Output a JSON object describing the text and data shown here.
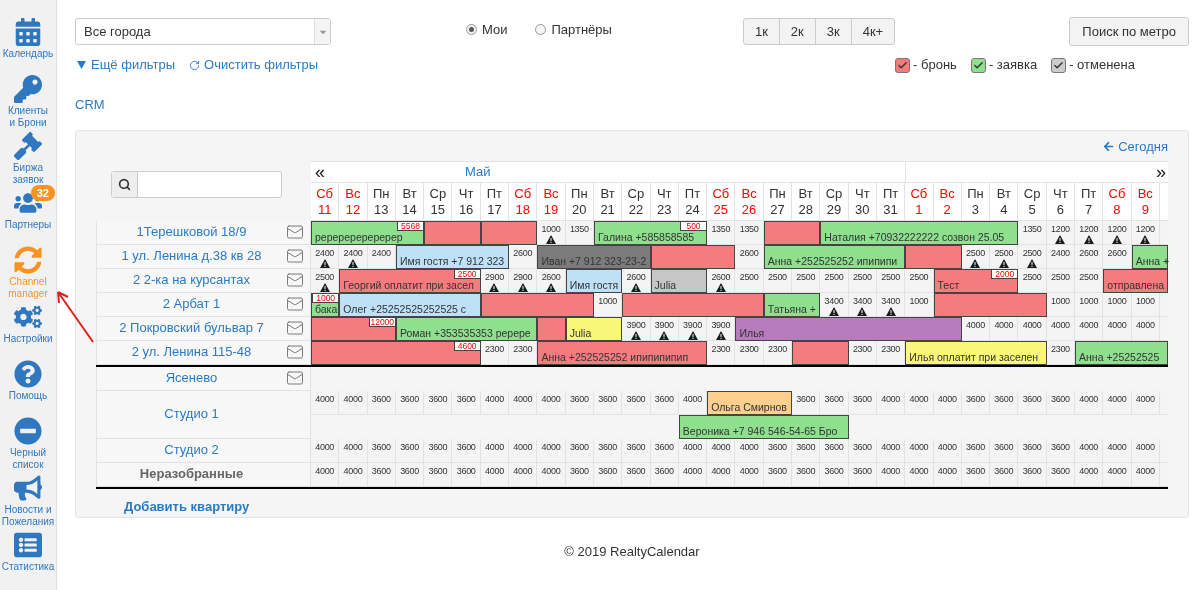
{
  "sidebar": {
    "items": [
      {
        "label": "Календарь",
        "selected": false
      },
      {
        "label": "Клиенты\nи Брони",
        "selected": false
      },
      {
        "label": "Биржа\nзаявок",
        "selected": false
      },
      {
        "label": "Партнеры",
        "selected": false,
        "badge": "32"
      },
      {
        "label": "Channel\nmanager",
        "selected": true
      },
      {
        "label": "Настройки",
        "selected": false
      },
      {
        "label": "Помощь",
        "selected": false
      },
      {
        "label": "Черный\nсписок",
        "selected": false
      },
      {
        "label": "Новости и\nПожелания",
        "selected": false
      },
      {
        "label": "Статистика",
        "selected": false
      }
    ]
  },
  "filters": {
    "city_select": "Все города",
    "scope": [
      {
        "label": "Мои",
        "selected": true
      },
      {
        "label": "Партнёры",
        "selected": false
      }
    ],
    "rooms": [
      "1к",
      "2к",
      "3к",
      "4к+"
    ],
    "metro_button": "Поиск по метро",
    "more_filters": "Ещё фильтры",
    "clear_filters": "Очистить фильтры",
    "legend": [
      {
        "label": "- бронь",
        "color": "#f47c7c"
      },
      {
        "label": "- заявка",
        "color": "#8ee08e"
      },
      {
        "label": "- отменена",
        "color": "#cccccc"
      }
    ],
    "crm_link": "CRM"
  },
  "calendar": {
    "today_link": "Сегодня",
    "prev": "«",
    "next": "»",
    "months": [
      {
        "label": "Май",
        "days": [
          {
            "weekday": "Сб",
            "date": "11",
            "weekend": true
          },
          {
            "weekday": "Вс",
            "date": "12",
            "weekend": true
          },
          {
            "weekday": "Пн",
            "date": "13",
            "weekend": false
          },
          {
            "weekday": "Вт",
            "date": "14",
            "weekend": false
          },
          {
            "weekday": "Ср",
            "date": "15",
            "weekend": false
          },
          {
            "weekday": "Чт",
            "date": "16",
            "weekend": false
          },
          {
            "weekday": "Пт",
            "date": "17",
            "weekend": false
          },
          {
            "weekday": "Сб",
            "date": "18",
            "weekend": true
          },
          {
            "weekday": "Вс",
            "date": "19",
            "weekend": true
          },
          {
            "weekday": "Пн",
            "date": "20",
            "weekend": false
          },
          {
            "weekday": "Вт",
            "date": "21",
            "weekend": false
          },
          {
            "weekday": "Ср",
            "date": "22",
            "weekend": false
          },
          {
            "weekday": "Чт",
            "date": "23",
            "weekend": false
          },
          {
            "weekday": "Пт",
            "date": "24",
            "weekend": false
          },
          {
            "weekday": "Сб",
            "date": "25",
            "weekend": true
          },
          {
            "weekday": "Вс",
            "date": "26",
            "weekend": true
          },
          {
            "weekday": "Пн",
            "date": "27",
            "weekend": false
          },
          {
            "weekday": "Вт",
            "date": "28",
            "weekend": false
          },
          {
            "weekday": "Ср",
            "date": "29",
            "weekend": false
          },
          {
            "weekday": "Чт",
            "date": "30",
            "weekend": false
          },
          {
            "weekday": "Пт",
            "date": "31",
            "weekend": false
          }
        ]
      },
      {
        "days": [
          {
            "weekday": "Сб",
            "date": "1",
            "weekend": true
          },
          {
            "weekday": "Вс",
            "date": "2",
            "weekend": true
          },
          {
            "weekday": "Пн",
            "date": "3",
            "weekend": false
          },
          {
            "weekday": "Вт",
            "date": "4",
            "weekend": false
          },
          {
            "weekday": "Ср",
            "date": "5",
            "weekend": false
          },
          {
            "weekday": "Чт",
            "date": "6",
            "weekend": false
          },
          {
            "weekday": "Пт",
            "date": "7",
            "weekend": false
          },
          {
            "weekday": "Сб",
            "date": "8",
            "weekend": true
          },
          {
            "weekday": "Вс",
            "date": "9",
            "weekend": true
          }
        ]
      }
    ],
    "rows": [
      {
        "kind": "apartment",
        "name": "1Терешковой 18/9",
        "mail": true,
        "lanes": [
          [
            {
              "kind": "booking",
              "text": "реререререререр",
              "color": "#8ee08e",
              "tag": "5568"
            },
            {
              "kind": "continued"
            },
            {
              "kind": "continued"
            },
            {
              "kind": "continued"
            },
            {
              "kind": "booking",
              "color": "#f47c7c"
            },
            {
              "kind": "continued"
            },
            {
              "kind": "booking",
              "color": "#f47c7c"
            },
            {
              "kind": "continued"
            },
            {
              "kind": "price",
              "price": "1000",
              "warning": true
            },
            {
              "kind": "price",
              "price": "1350",
              "warning": false
            },
            {
              "kind": "booking",
              "text": "Галина +585858585",
              "color": "#8ee08e",
              "tag": "500"
            },
            {
              "kind": "continued"
            },
            {
              "kind": "continued"
            },
            {
              "kind": "continued"
            },
            {
              "kind": "price",
              "price": "1350",
              "warning": false
            },
            {
              "kind": "price",
              "price": "1350",
              "warning": false
            },
            {
              "kind": "booking",
              "color": "#f47c7c"
            },
            {
              "kind": "continued"
            },
            {
              "kind": "booking",
              "text": "Наталия +70932222222 созвон 25.05",
              "color": "#8ee08e"
            },
            {
              "kind": "continued"
            },
            {
              "kind": "continued"
            },
            {
              "kind": "continued"
            },
            {
              "kind": "continued"
            },
            {
              "kind": "continued"
            },
            {
              "kind": "continued"
            },
            {
              "kind": "price",
              "price": "1350",
              "warning": false
            },
            {
              "kind": "price",
              "price": "1200",
              "warning": true
            },
            {
              "kind": "price",
              "price": "1200",
              "warning": true
            },
            {
              "kind": "price",
              "price": "1200",
              "warning": true
            },
            {
              "kind": "price",
              "price": "1200",
              "warning": true
            }
          ]
        ]
      },
      {
        "kind": "apartment",
        "name": "1 ул. Ленина д.38 кв 28",
        "mail": true,
        "lanes": [
          [
            {
              "kind": "price",
              "price": "2400",
              "warning": true
            },
            {
              "kind": "price",
              "price": "2400",
              "warning": true
            },
            {
              "kind": "price",
              "price": "2400",
              "warning": false
            },
            {
              "kind": "booking",
              "text": "Имя гостя +7 912 323",
              "color": "#bfe1f7"
            },
            {
              "kind": "continued"
            },
            {
              "kind": "continued"
            },
            {
              "kind": "continued"
            },
            {
              "kind": "price",
              "price": "2600",
              "warning": false
            },
            {
              "kind": "booking",
              "text": "Иван +7 912 323-23-2",
              "color": "#7b7b7b"
            },
            {
              "kind": "continued"
            },
            {
              "kind": "continued"
            },
            {
              "kind": "continued"
            },
            {
              "kind": "booking",
              "color": "#f47c7c"
            },
            {
              "kind": "continued"
            },
            {
              "kind": "continued"
            },
            {
              "kind": "price",
              "price": "2600",
              "warning": false
            },
            {
              "kind": "booking",
              "text": "Анна +252525252 ипипипи",
              "color": "#8ee08e"
            },
            {
              "kind": "continued"
            },
            {
              "kind": "continued"
            },
            {
              "kind": "continued"
            },
            {
              "kind": "continued"
            },
            {
              "kind": "booking",
              "color": "#f47c7c"
            },
            {
              "kind": "continued"
            },
            {
              "kind": "price",
              "price": "2500",
              "warning": true
            },
            {
              "kind": "price",
              "price": "2500",
              "warning": true
            },
            {
              "kind": "price",
              "price": "2500",
              "warning": true
            },
            {
              "kind": "price",
              "price": "2400",
              "warning": false
            },
            {
              "kind": "price",
              "price": "2600",
              "warning": false
            },
            {
              "kind": "price",
              "price": "2600",
              "warning": false
            },
            {
              "kind": "booking",
              "text": "Анна +",
              "color": "#8ee08e"
            }
          ]
        ]
      },
      {
        "kind": "apartment",
        "name": "2 2-ка на курсантах",
        "mail": true,
        "lanes": [
          [
            {
              "kind": "price",
              "price": "2500",
              "warning": true
            },
            {
              "kind": "booking",
              "text": "Георгий оплатит при засел",
              "color": "#f47c7c",
              "tag": "2500"
            },
            {
              "kind": "continued"
            },
            {
              "kind": "continued"
            },
            {
              "kind": "continued"
            },
            {
              "kind": "continued"
            },
            {
              "kind": "price",
              "price": "2900",
              "warning": true
            },
            {
              "kind": "price",
              "price": "2900",
              "warning": true
            },
            {
              "kind": "price",
              "price": "2600",
              "warning": true
            },
            {
              "kind": "booking",
              "text": "Имя гостя",
              "color": "#bfe1f7"
            },
            {
              "kind": "continued"
            },
            {
              "kind": "price",
              "price": "2600",
              "warning": true
            },
            {
              "kind": "booking",
              "text": "Julia",
              "color": "#c6c6c6"
            },
            {
              "kind": "continued"
            },
            {
              "kind": "price",
              "price": "2600",
              "warning": true
            },
            {
              "kind": "price",
              "price": "2500",
              "warning": false
            },
            {
              "kind": "price",
              "price": "2500",
              "warning": false
            },
            {
              "kind": "price",
              "price": "2500",
              "warning": false
            },
            {
              "kind": "price",
              "price": "2500",
              "warning": false
            },
            {
              "kind": "price",
              "price": "2500",
              "warning": false
            },
            {
              "kind": "price",
              "price": "2500",
              "warning": false
            },
            {
              "kind": "price",
              "price": "2500",
              "warning": false
            },
            {
              "kind": "booking",
              "text": "Тест",
              "color": "#f47c7c",
              "tag": "2000"
            },
            {
              "kind": "continued"
            },
            {
              "kind": "continued"
            },
            {
              "kind": "price",
              "price": "2500",
              "warning": false
            },
            {
              "kind": "price",
              "price": "2500",
              "warning": false
            },
            {
              "kind": "price",
              "price": "2500",
              "warning": false
            },
            {
              "kind": "booking",
              "text": "отправлена",
              "color": "#f47c7c"
            },
            {
              "kind": "continued"
            }
          ]
        ]
      },
      {
        "kind": "apartment",
        "name": "2 Арбат 1",
        "mail": true,
        "lanes": [
          [
            {
              "kind": "booking",
              "text": "бака",
              "color": "#8ee08e",
              "tag": "1000"
            },
            {
              "kind": "booking",
              "text": "Олег +25252525252525 с",
              "color": "#bfe1f7"
            },
            {
              "kind": "continued"
            },
            {
              "kind": "continued"
            },
            {
              "kind": "continued"
            },
            {
              "kind": "continued"
            },
            {
              "kind": "booking",
              "color": "#f47c7c"
            },
            {
              "kind": "continued"
            },
            {
              "kind": "continued"
            },
            {
              "kind": "continued"
            },
            {
              "kind": "price",
              "price": "1000",
              "warning": false
            },
            {
              "kind": "booking",
              "color": "#f47c7c"
            },
            {
              "kind": "continued"
            },
            {
              "kind": "continued"
            },
            {
              "kind": "continued"
            },
            {
              "kind": "continued"
            },
            {
              "kind": "booking",
              "text": "Татьяна +",
              "color": "#8ee08e"
            },
            {
              "kind": "continued"
            },
            {
              "kind": "price",
              "price": "3400",
              "warning": true
            },
            {
              "kind": "price",
              "price": "3400",
              "warning": true
            },
            {
              "kind": "price",
              "price": "3400",
              "warning": true
            },
            {
              "kind": "price",
              "price": "1000",
              "warning": false
            },
            {
              "kind": "booking",
              "color": "#f47c7c"
            },
            {
              "kind": "continued"
            },
            {
              "kind": "continued"
            },
            {
              "kind": "continued"
            },
            {
              "kind": "price",
              "price": "1000",
              "warning": false
            },
            {
              "kind": "price",
              "price": "1000",
              "warning": false
            },
            {
              "kind": "price",
              "price": "1000",
              "warning": false
            },
            {
              "kind": "price",
              "price": "1000",
              "warning": false
            }
          ]
        ]
      },
      {
        "kind": "apartment",
        "name": "2 Покровский бульвар 7",
        "mail": true,
        "lanes": [
          [
            {
              "kind": "booking",
              "color": "#f47c7c",
              "tag": "12000"
            },
            {
              "kind": "continued"
            },
            {
              "kind": "continued"
            },
            {
              "kind": "booking",
              "text": "Роман +353535353 ререре",
              "color": "#8ee08e"
            },
            {
              "kind": "continued"
            },
            {
              "kind": "continued"
            },
            {
              "kind": "continued"
            },
            {
              "kind": "continued"
            },
            {
              "kind": "booking",
              "color": "#f47c7c"
            },
            {
              "kind": "booking",
              "text": "Julia",
              "color": "#faf67a"
            },
            {
              "kind": "continued"
            },
            {
              "kind": "price",
              "price": "3900",
              "warning": true
            },
            {
              "kind": "price",
              "price": "3900",
              "warning": true
            },
            {
              "kind": "price",
              "price": "3900",
              "warning": true
            },
            {
              "kind": "price",
              "price": "3900",
              "warning": true
            },
            {
              "kind": "booking",
              "text": "Илья",
              "color": "#b87bbd"
            },
            {
              "kind": "continued"
            },
            {
              "kind": "continued"
            },
            {
              "kind": "continued"
            },
            {
              "kind": "continued"
            },
            {
              "kind": "continued"
            },
            {
              "kind": "continued"
            },
            {
              "kind": "continued"
            },
            {
              "kind": "price",
              "price": "4000",
              "warning": false
            },
            {
              "kind": "price",
              "price": "4000",
              "warning": false
            },
            {
              "kind": "price",
              "price": "4000",
              "warning": false
            },
            {
              "kind": "price",
              "price": "4000",
              "warning": false
            },
            {
              "kind": "price",
              "price": "4000",
              "warning": false
            },
            {
              "kind": "price",
              "price": "4000",
              "warning": false
            },
            {
              "kind": "price",
              "price": "4000",
              "warning": false
            }
          ]
        ]
      },
      {
        "kind": "apartment",
        "name": "2 ул. Ленина 115-48",
        "mail": true,
        "lanes": [
          [
            {
              "kind": "booking",
              "color": "#f47c7c",
              "tag": "4600"
            },
            {
              "kind": "continued"
            },
            {
              "kind": "continued"
            },
            {
              "kind": "continued"
            },
            {
              "kind": "continued"
            },
            {
              "kind": "continued"
            },
            {
              "kind": "price",
              "price": "2300",
              "warning": false
            },
            {
              "kind": "price",
              "price": "2300",
              "warning": false
            },
            {
              "kind": "booking",
              "text": "Анна +252525252 ипипипипип",
              "color": "#f47c7c"
            },
            {
              "kind": "continued"
            },
            {
              "kind": "continued"
            },
            {
              "kind": "continued"
            },
            {
              "kind": "continued"
            },
            {
              "kind": "continued"
            },
            {
              "kind": "price",
              "price": "2300",
              "warning": false
            },
            {
              "kind": "price",
              "price": "2300",
              "warning": false
            },
            {
              "kind": "price",
              "price": "2300",
              "warning": false
            },
            {
              "kind": "booking",
              "color": "#f47c7c"
            },
            {
              "kind": "continued"
            },
            {
              "kind": "price",
              "price": "2300",
              "warning": false
            },
            {
              "kind": "price",
              "price": "2300",
              "warning": false
            },
            {
              "kind": "booking",
              "text": "Илья оплатит при заселен",
              "color": "#faf67a"
            },
            {
              "kind": "continued"
            },
            {
              "kind": "continued"
            },
            {
              "kind": "continued"
            },
            {
              "kind": "continued"
            },
            {
              "kind": "price",
              "price": "2300",
              "warning": false
            },
            {
              "kind": "booking",
              "text": "Анна +25252525",
              "color": "#8ee08e"
            },
            {
              "kind": "continued"
            },
            {
              "kind": "continued"
            }
          ]
        ]
      },
      {
        "kind": "group",
        "name": "Ясенево",
        "mail": true,
        "lanes": [
          [
            {
              "kind": "blank"
            },
            {
              "kind": "blank"
            },
            {
              "kind": "blank"
            },
            {
              "kind": "blank"
            },
            {
              "kind": "blank"
            },
            {
              "kind": "blank"
            },
            {
              "kind": "blank"
            },
            {
              "kind": "blank"
            },
            {
              "kind": "blank"
            },
            {
              "kind": "blank"
            },
            {
              "kind": "blank"
            },
            {
              "kind": "blank"
            },
            {
              "kind": "blank"
            },
            {
              "kind": "blank"
            },
            {
              "kind": "blank"
            },
            {
              "kind": "blank"
            },
            {
              "kind": "blank"
            },
            {
              "kind": "blank"
            },
            {
              "kind": "blank"
            },
            {
              "kind": "blank"
            },
            {
              "kind": "blank"
            },
            {
              "kind": "blank"
            },
            {
              "kind": "blank"
            },
            {
              "kind": "blank"
            },
            {
              "kind": "blank"
            },
            {
              "kind": "blank"
            },
            {
              "kind": "blank"
            },
            {
              "kind": "blank"
            },
            {
              "kind": "blank"
            },
            {
              "kind": "blank"
            }
          ]
        ]
      },
      {
        "kind": "apartment",
        "name": "Студио 1",
        "mail": false,
        "lanes": [
          [
            {
              "kind": "price",
              "price": "4000",
              "warning": false
            },
            {
              "kind": "price",
              "price": "4000",
              "warning": false
            },
            {
              "kind": "price",
              "price": "3600",
              "warning": false
            },
            {
              "kind": "price",
              "price": "3600",
              "warning": false
            },
            {
              "kind": "price",
              "price": "3600",
              "warning": false
            },
            {
              "kind": "price",
              "price": "3600",
              "warning": false
            },
            {
              "kind": "price",
              "price": "4000",
              "warning": false
            },
            {
              "kind": "price",
              "price": "4000",
              "warning": false
            },
            {
              "kind": "price",
              "price": "4000",
              "warning": false
            },
            {
              "kind": "price",
              "price": "3600",
              "warning": false
            },
            {
              "kind": "price",
              "price": "3600",
              "warning": false
            },
            {
              "kind": "price",
              "price": "3600",
              "warning": false
            },
            {
              "kind": "price",
              "price": "3600",
              "warning": false
            },
            {
              "kind": "price",
              "price": "4000",
              "warning": false
            },
            {
              "kind": "booking",
              "text": "Ольга Смирнов",
              "color": "#fbd08e"
            },
            {
              "kind": "continued"
            },
            {
              "kind": "continued"
            },
            {
              "kind": "price",
              "price": "3600",
              "warning": false
            },
            {
              "kind": "price",
              "price": "3600",
              "warning": false
            },
            {
              "kind": "price",
              "price": "3600",
              "warning": false
            },
            {
              "kind": "price",
              "price": "4000",
              "warning": false
            },
            {
              "kind": "price",
              "price": "4000",
              "warning": false
            },
            {
              "kind": "price",
              "price": "4000",
              "warning": false
            },
            {
              "kind": "price",
              "price": "3600",
              "warning": false
            },
            {
              "kind": "price",
              "price": "3600",
              "warning": false
            },
            {
              "kind": "price",
              "price": "3600",
              "warning": false
            },
            {
              "kind": "price",
              "price": "3600",
              "warning": false
            },
            {
              "kind": "price",
              "price": "4000",
              "warning": false
            },
            {
              "kind": "price",
              "price": "4000",
              "warning": false
            },
            {
              "kind": "price",
              "price": "4000",
              "warning": false
            }
          ],
          [
            {
              "kind": "blank"
            },
            {
              "kind": "blank"
            },
            {
              "kind": "blank"
            },
            {
              "kind": "blank"
            },
            {
              "kind": "blank"
            },
            {
              "kind": "blank"
            },
            {
              "kind": "blank"
            },
            {
              "kind": "blank"
            },
            {
              "kind": "blank"
            },
            {
              "kind": "blank"
            },
            {
              "kind": "blank"
            },
            {
              "kind": "blank"
            },
            {
              "kind": "blank"
            },
            {
              "kind": "booking",
              "text": "Вероника +7 946 546-54-65 Бро",
              "color": "#8ee08e"
            },
            {
              "kind": "continued"
            },
            {
              "kind": "continued"
            },
            {
              "kind": "continued"
            },
            {
              "kind": "continued"
            },
            {
              "kind": "continued"
            },
            {
              "kind": "blank"
            },
            {
              "kind": "blank"
            },
            {
              "kind": "blank"
            },
            {
              "kind": "blank"
            },
            {
              "kind": "blank"
            },
            {
              "kind": "blank"
            },
            {
              "kind": "blank"
            },
            {
              "kind": "blank"
            },
            {
              "kind": "blank"
            },
            {
              "kind": "blank"
            },
            {
              "kind": "blank"
            }
          ]
        ]
      },
      {
        "kind": "apartment",
        "name": "Студио 2",
        "mail": false,
        "lanes": [
          [
            {
              "kind": "price",
              "price": "4000",
              "warning": false
            },
            {
              "kind": "price",
              "price": "4000",
              "warning": false
            },
            {
              "kind": "price",
              "price": "3600",
              "warning": false
            },
            {
              "kind": "price",
              "price": "3600",
              "warning": false
            },
            {
              "kind": "price",
              "price": "3600",
              "warning": false
            },
            {
              "kind": "price",
              "price": "3600",
              "warning": false
            },
            {
              "kind": "price",
              "price": "4000",
              "warning": false
            },
            {
              "kind": "price",
              "price": "4000",
              "warning": false
            },
            {
              "kind": "price",
              "price": "4000",
              "warning": false
            },
            {
              "kind": "price",
              "price": "3600",
              "warning": false
            },
            {
              "kind": "price",
              "price": "3600",
              "warning": false
            },
            {
              "kind": "price",
              "price": "3600",
              "warning": false
            },
            {
              "kind": "price",
              "price": "3600",
              "warning": false
            },
            {
              "kind": "price",
              "price": "4000",
              "warning": false
            },
            {
              "kind": "price",
              "price": "4000",
              "warning": false
            },
            {
              "kind": "price",
              "price": "4000",
              "warning": false
            },
            {
              "kind": "price",
              "price": "3600",
              "warning": false
            },
            {
              "kind": "price",
              "price": "3600",
              "warning": false
            },
            {
              "kind": "price",
              "price": "3600",
              "warning": false
            },
            {
              "kind": "price",
              "price": "3600",
              "warning": false
            },
            {
              "kind": "price",
              "price": "4000",
              "warning": false
            },
            {
              "kind": "price",
              "price": "4000",
              "warning": false
            },
            {
              "kind": "price",
              "price": "4000",
              "warning": false
            },
            {
              "kind": "price",
              "price": "3600",
              "warning": false
            },
            {
              "kind": "price",
              "price": "3600",
              "warning": false
            },
            {
              "kind": "price",
              "price": "3600",
              "warning": false
            },
            {
              "kind": "price",
              "price": "3600",
              "warning": false
            },
            {
              "kind": "price",
              "price": "4000",
              "warning": false
            },
            {
              "kind": "price",
              "price": "4000",
              "warning": false
            },
            {
              "kind": "price",
              "price": "4000",
              "warning": false
            }
          ]
        ]
      },
      {
        "kind": "unsorted",
        "name": "Неразобранные",
        "mail": false,
        "lanes": [
          [
            {
              "kind": "price",
              "price": "4000",
              "warning": false
            },
            {
              "kind": "price",
              "price": "4000",
              "warning": false
            },
            {
              "kind": "price",
              "price": "3600",
              "warning": false
            },
            {
              "kind": "price",
              "price": "3600",
              "warning": false
            },
            {
              "kind": "price",
              "price": "3600",
              "warning": false
            },
            {
              "kind": "price",
              "price": "3600",
              "warning": false
            },
            {
              "kind": "price",
              "price": "4000",
              "warning": false
            },
            {
              "kind": "price",
              "price": "4000",
              "warning": false
            },
            {
              "kind": "price",
              "price": "4000",
              "warning": false
            },
            {
              "kind": "price",
              "price": "3600",
              "warning": false
            },
            {
              "kind": "price",
              "price": "3600",
              "warning": false
            },
            {
              "kind": "price",
              "price": "3600",
              "warning": false
            },
            {
              "kind": "price",
              "price": "3600",
              "warning": false
            },
            {
              "kind": "price",
              "price": "4000",
              "warning": false
            },
            {
              "kind": "price",
              "price": "4000",
              "warning": false
            },
            {
              "kind": "price",
              "price": "4000",
              "warning": false
            },
            {
              "kind": "price",
              "price": "3600",
              "warning": false
            },
            {
              "kind": "price",
              "price": "3600",
              "warning": false
            },
            {
              "kind": "price",
              "price": "3600",
              "warning": false
            },
            {
              "kind": "price",
              "price": "3600",
              "warning": false
            },
            {
              "kind": "price",
              "price": "4000",
              "warning": false
            },
            {
              "kind": "price",
              "price": "4000",
              "warning": false
            },
            {
              "kind": "price",
              "price": "4000",
              "warning": false
            },
            {
              "kind": "price",
              "price": "3600",
              "warning": false
            },
            {
              "kind": "price",
              "price": "3600",
              "warning": false
            },
            {
              "kind": "price",
              "price": "3600",
              "warning": false
            },
            {
              "kind": "price",
              "price": "3600",
              "warning": false
            },
            {
              "kind": "price",
              "price": "4000",
              "warning": false
            },
            {
              "kind": "price",
              "price": "4000",
              "warning": false
            },
            {
              "kind": "price",
              "price": "4000",
              "warning": false
            }
          ]
        ]
      }
    ],
    "add_apartment": "Добавить квартиру"
  },
  "footer": "© 2019 RealtyCalendar"
}
